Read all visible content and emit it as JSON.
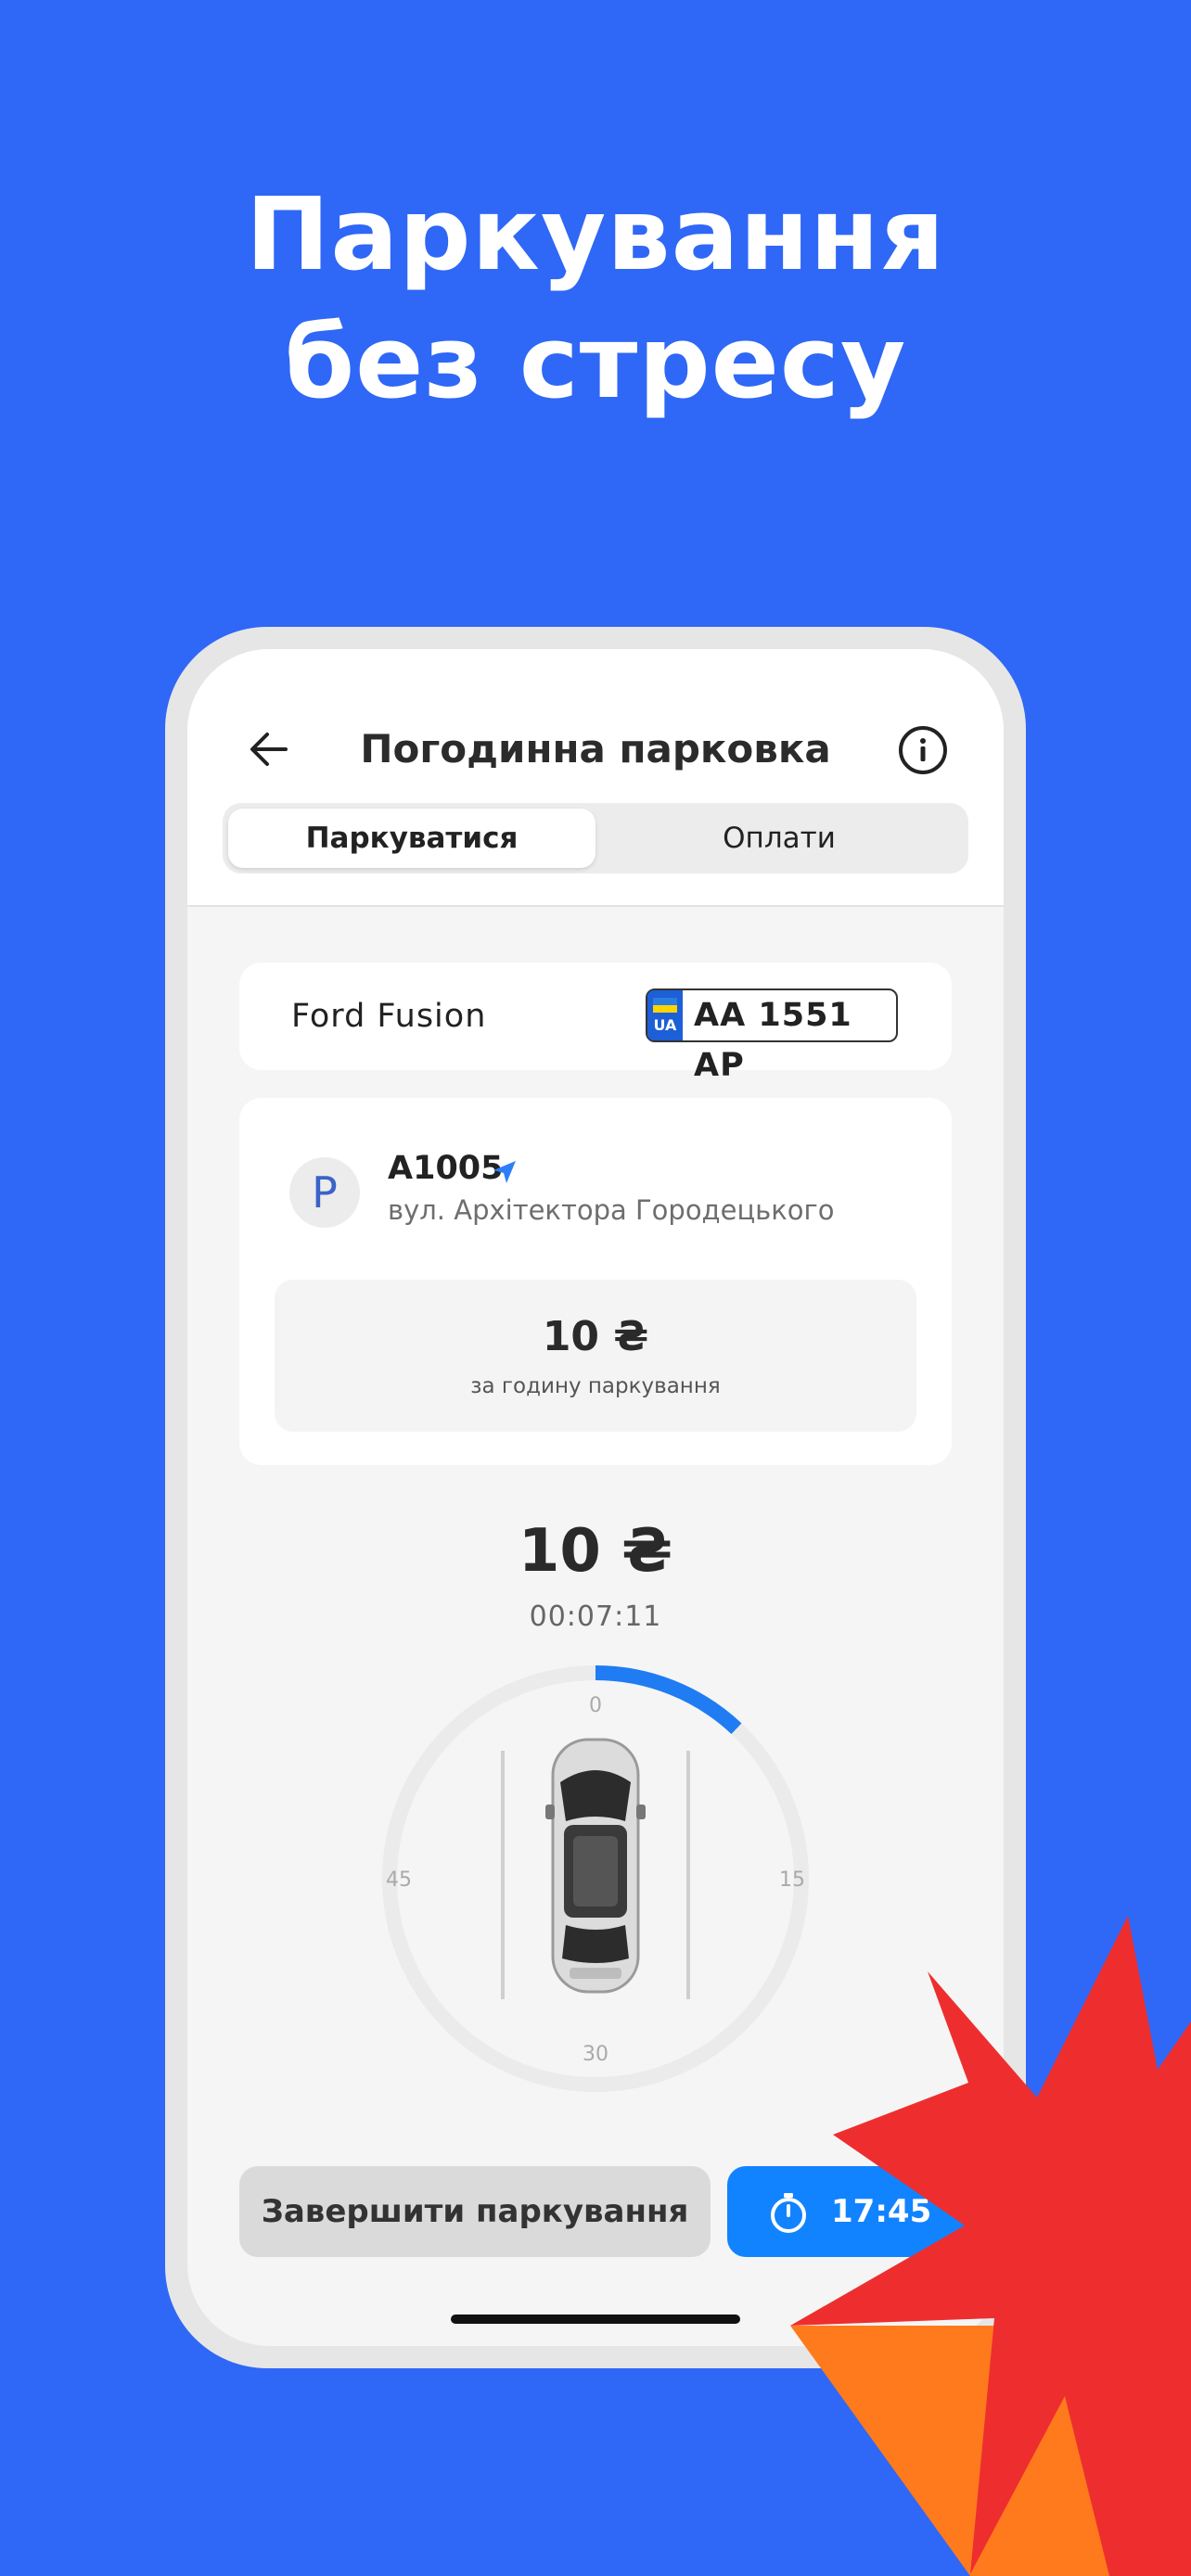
{
  "headline": {
    "line1": "Паркування",
    "line2": "без стресу"
  },
  "header": {
    "back_icon": "arrow-left-icon",
    "title": "Погодинна парковка",
    "info_icon": "info-circle-icon"
  },
  "tabs": [
    {
      "label": "Паркуватися",
      "active": true
    },
    {
      "label": "Оплати",
      "active": false
    }
  ],
  "vehicle": {
    "name": "Ford Fusion",
    "plate_country": "UA",
    "plate_number": "AA 1551 AP"
  },
  "zone": {
    "badge": "P",
    "code": "A1005",
    "street": "вул. Архітектора Городецького",
    "price": "10 ₴",
    "price_caption": "за годину паркування"
  },
  "session": {
    "total": "10 ₴",
    "elapsed": "00:07:11",
    "dial_labels": [
      "0",
      "15",
      "30",
      "45"
    ],
    "dial_progress_minutes": 7.2,
    "dial_total_minutes": 60
  },
  "actions": {
    "finish_label": "Завершити паркування",
    "timer_icon": "stopwatch-icon",
    "timer_value": "17:45"
  },
  "colors": {
    "background": "#2f67f6",
    "accent": "#1283ff",
    "burst_red": "#ee2e2e",
    "burst_orange": "#ff7a1c"
  }
}
